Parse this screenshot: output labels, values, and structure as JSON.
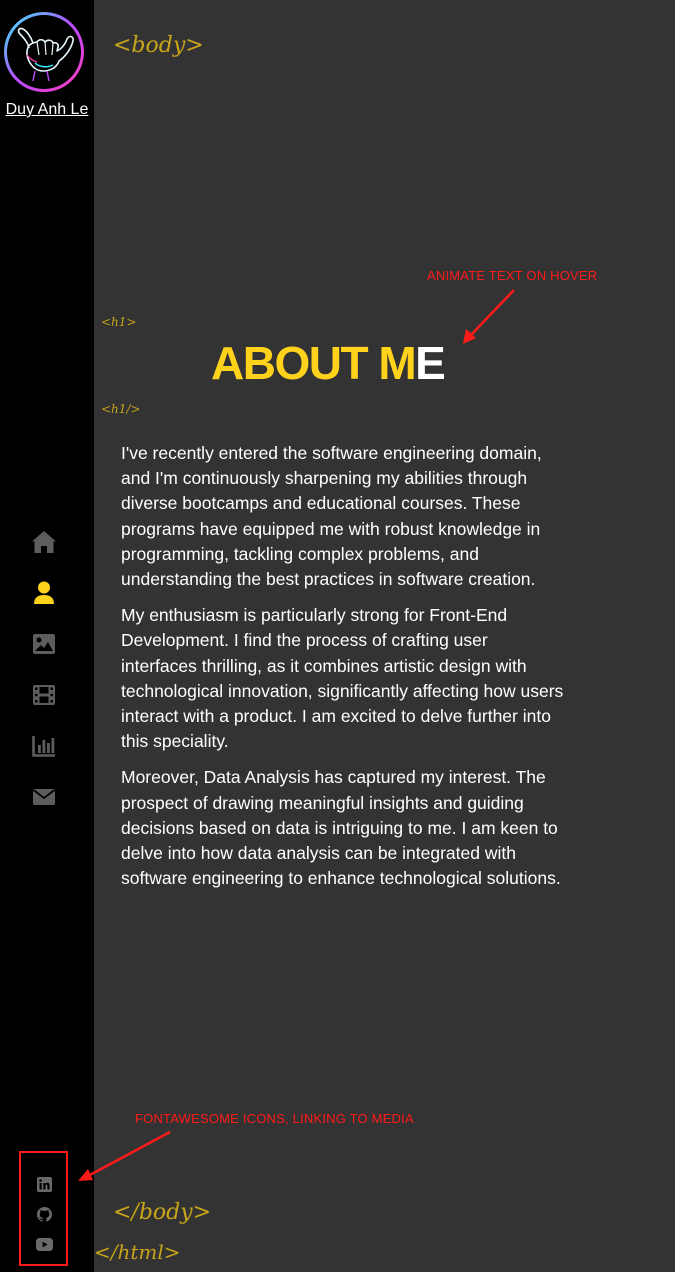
{
  "sidebar": {
    "name": "Duy Anh Le",
    "nav": [
      {
        "icon": "home-icon",
        "active": false
      },
      {
        "icon": "user-icon",
        "active": true
      },
      {
        "icon": "image-icon",
        "active": false
      },
      {
        "icon": "film-icon",
        "active": false
      },
      {
        "icon": "chart-icon",
        "active": false
      },
      {
        "icon": "envelope-icon",
        "active": false
      }
    ],
    "social": [
      {
        "icon": "linkedin-icon"
      },
      {
        "icon": "github-icon"
      },
      {
        "icon": "youtube-icon"
      }
    ]
  },
  "tags": {
    "body_open": "<body>",
    "body_close": "</body>",
    "html_close": "</html>",
    "h1_open": "<h1>",
    "h1_close": "<h1/>"
  },
  "annotations": {
    "animate": "ANIMATE TEXT ON HOVER",
    "fontawesome": "FONTAWESOME ICONS, LINKING TO MEDIA"
  },
  "heading": {
    "main": "ABOUT M",
    "last": "E"
  },
  "about": {
    "paragraphs": [
      "I've recently entered the software engineering domain, and I'm continuously sharpening my abilities through diverse bootcamps and educational courses. These programs have equipped me with robust knowledge in programming, tackling complex problems, and understanding the best practices in software creation.",
      "My enthusiasm is particularly strong for Front-End Development. I find the process of crafting user interfaces thrilling, as it combines artistic design with technological innovation, significantly affecting how users interact with a product. I am excited to delve further into this speciality.",
      "Moreover, Data Analysis has captured my interest. The prospect of drawing meaningful insights and guiding decisions based on data is intriguing to me. I am keen to delve into how data analysis can be integrated with software engineering to enhance technological solutions."
    ]
  },
  "colors": {
    "accent": "#ffd21c",
    "nav_inactive": "#5d5d5d",
    "annotation": "#ff1a1a",
    "tag": "#c7a41a"
  }
}
